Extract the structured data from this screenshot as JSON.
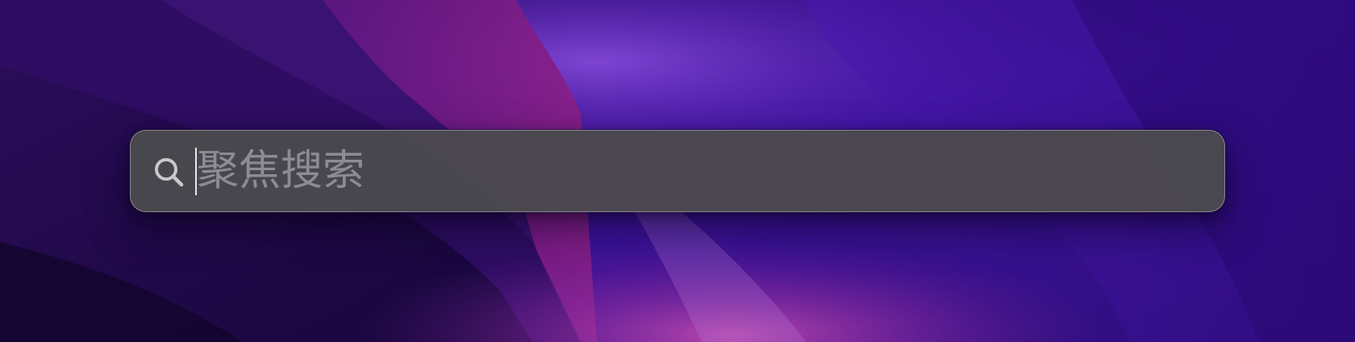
{
  "spotlight": {
    "placeholder": "聚焦搜索",
    "value": "",
    "search_icon": "magnifying-glass-icon"
  },
  "colors": {
    "wallpaper_base": "#2a0f6e",
    "wallpaper_magenta": "#8c1d8a",
    "wallpaper_violet": "#6a2fd4",
    "bar_background": "#4a484e",
    "bar_border": "#a09ca8",
    "placeholder_text": "#8e8c93",
    "icon": "#c9c8cd",
    "caret": "#e9e8ee"
  }
}
